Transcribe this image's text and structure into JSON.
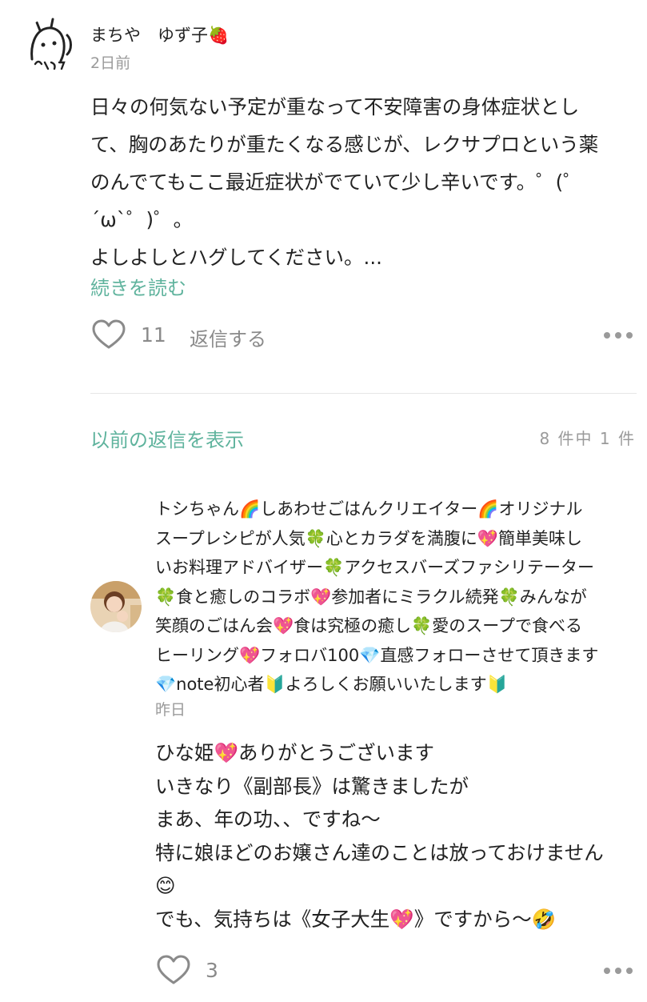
{
  "comment": {
    "author": "まちや　ゆず子",
    "author_emoji": "🍓",
    "date": "2日前",
    "body_lines": [
      "日々の何気ない予定が重なって不安障害の身体症状とし",
      "て、胸のあたりが重たくなる感じが、レクサプロという薬",
      "のんでてもここ最近症状がでていて少し辛いです。゜(゜",
      "´ω`゜)゜。",
      "よしよしとハグしてください。..."
    ],
    "read_more": "続きを読む",
    "like_count": "11",
    "reply_label": "返信する",
    "icons": {
      "like": "heart-outline-icon",
      "more": "more-dots-icon"
    }
  },
  "replies_header": {
    "show_previous": "以前の返信を表示",
    "count_label": "8 件中 1 件"
  },
  "reply": {
    "author_lines": [
      "トシちゃん🌈しあわせごはんクリエイター🌈オリジナル",
      "スープレシピが人気🍀心とカラダを満腹に💖簡単美味し",
      "いお料理アドバイザー🍀アクセスバーズファシリテーター",
      "🍀食と癒しのコラボ💖参加者にミラクル続発🍀みんなが",
      "笑顔のごはん会💖食は究極の癒し🍀愛のスープで食べる",
      "ヒーリング💖フォロバ100💎直感フォローさせて頂きます",
      "💎note初心者🔰よろしくお願いいたします🔰"
    ],
    "date": "昨日",
    "body_lines": [
      "ひな姫💖ありがとうございます",
      "いきなり《副部長》は驚きましたが",
      "まあ、年の功、、ですね〜",
      "特に娘ほどのお嬢さん達のことは放っておけません",
      "😊",
      "でも、気持ちは《女子大生💖》ですから〜🤣"
    ],
    "like_count": "3"
  }
}
